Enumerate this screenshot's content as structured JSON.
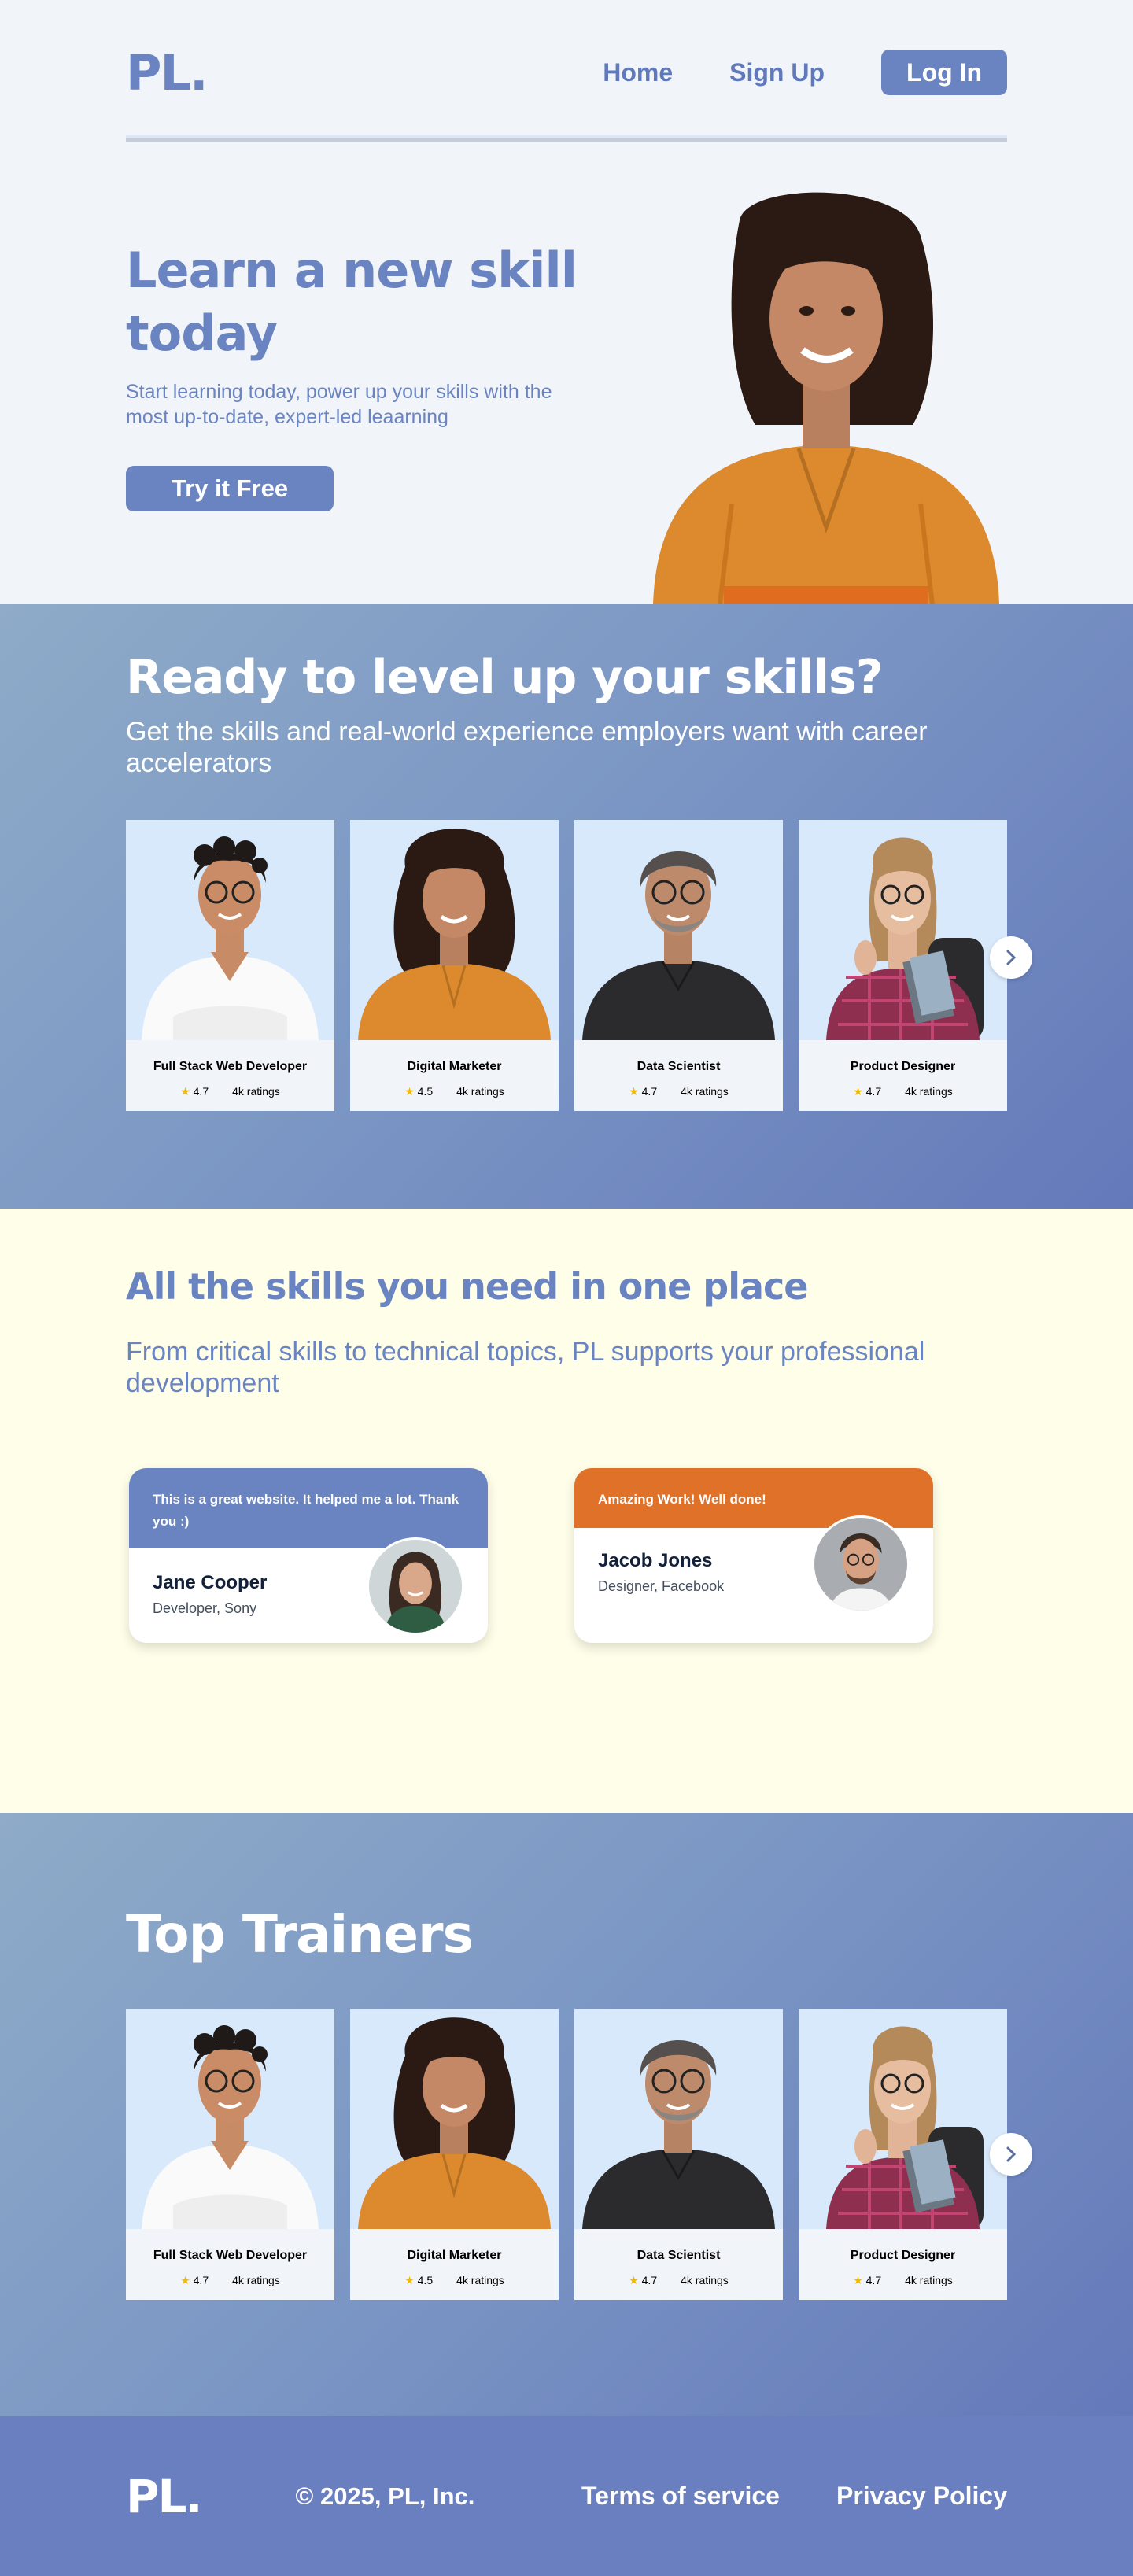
{
  "header": {
    "logo": "PL.",
    "nav": {
      "home": "Home",
      "signup": "Sign Up",
      "login": "Log In"
    }
  },
  "hero": {
    "title": "Learn a new skill today",
    "subtitle": "Start learning today, power up your skills with the most up-to-date, expert-led leaarning",
    "cta": "Try it Free"
  },
  "levelup": {
    "title": "Ready to level up your skills?",
    "subtitle": "Get the skills and real-world  experience employers want with career accelerators",
    "cards": [
      {
        "title": "Full Stack Web Developer",
        "rating": "4.7",
        "ratings": "4k ratings"
      },
      {
        "title": "Digital Marketer",
        "rating": "4.5",
        "ratings": "4k ratings"
      },
      {
        "title": "Data Scientist",
        "rating": "4.7",
        "ratings": "4k ratings"
      },
      {
        "title": "Product Designer",
        "rating": "4.7",
        "ratings": "4k ratings"
      }
    ]
  },
  "skills": {
    "title": "All the skills you need in one place",
    "subtitle": "From critical skills to technical topics, PL supports your professional development",
    "testimonials": [
      {
        "quote": "This is a great website. It helped me a lot. Thank you :)",
        "name": "Jane Cooper",
        "role": "Developer, Sony",
        "color": "#6a84c1"
      },
      {
        "quote": "Amazing Work! Well done!",
        "name": "Jacob Jones",
        "role": "Designer, Facebook",
        "color": "#e07128"
      }
    ]
  },
  "trainers": {
    "title": "Top Trainers",
    "cards": [
      {
        "title": "Full Stack Web Developer",
        "rating": "4.7",
        "ratings": "4k ratings"
      },
      {
        "title": "Digital Marketer",
        "rating": "4.5",
        "ratings": "4k ratings"
      },
      {
        "title": "Data Scientist",
        "rating": "4.7",
        "ratings": "4k ratings"
      },
      {
        "title": "Product Designer",
        "rating": "4.7",
        "ratings": "4k ratings"
      }
    ]
  },
  "footer": {
    "logo": "PL.",
    "copyright": "© 2025, PL, Inc.",
    "terms": "Terms of service",
    "privacy": "Privacy Policy"
  },
  "colors": {
    "brand": "#6a84c1",
    "orange": "#e07128",
    "cream": "#fefee9",
    "star": "#f1b900"
  },
  "icons": {
    "next": "chevron-right-icon",
    "star": "star-icon"
  }
}
